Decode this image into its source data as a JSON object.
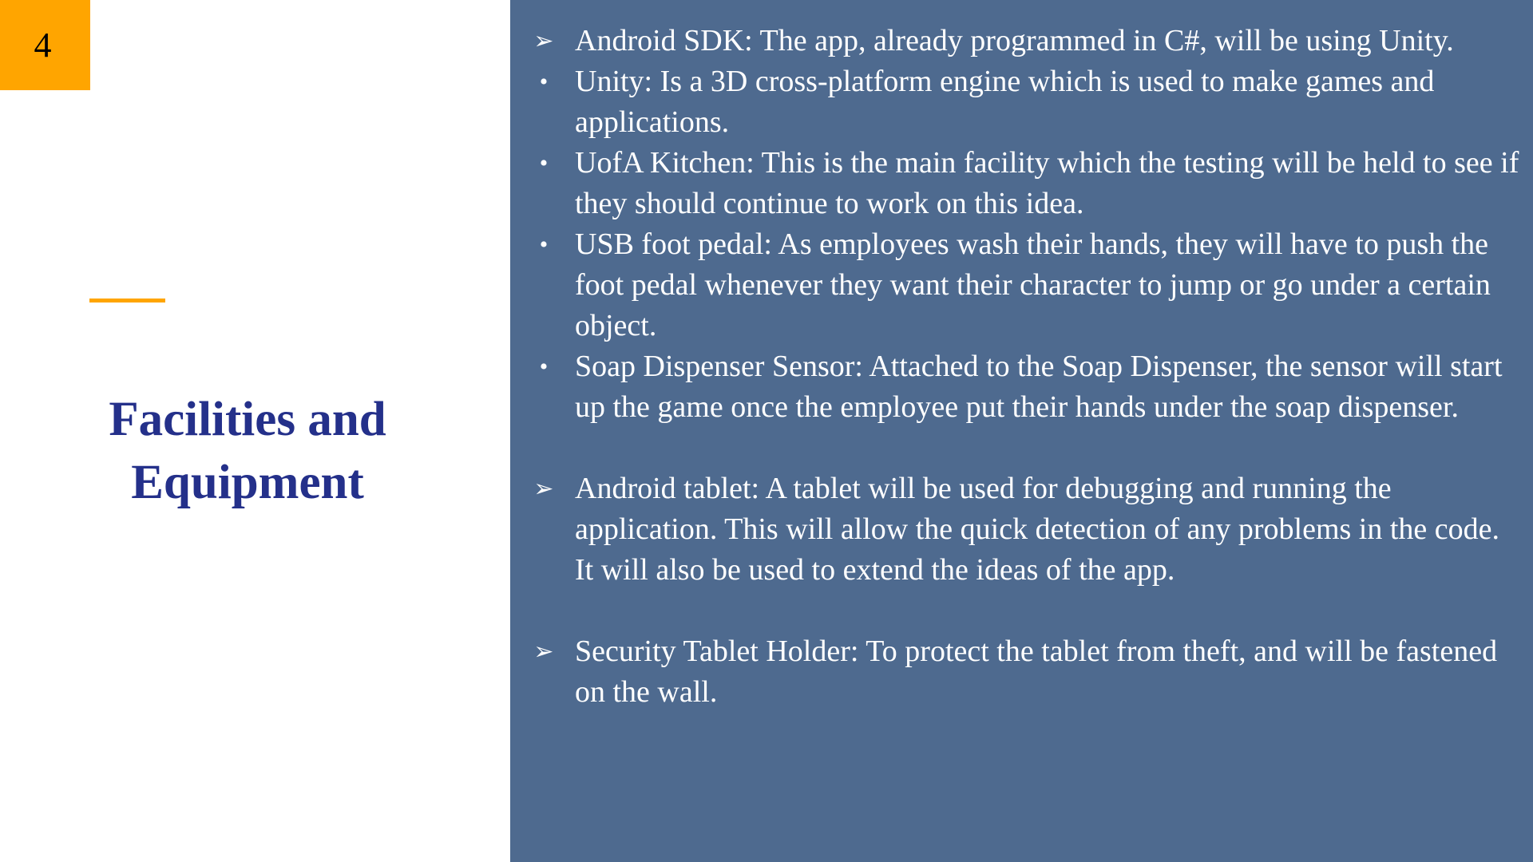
{
  "slide": {
    "number": "4",
    "title_line1": "Facilities and",
    "title_line2": "Equipment"
  },
  "colors": {
    "accent": "#FFA500",
    "title": "#24308A",
    "panel": "#4E6A8F",
    "body_text": "#FFFFFF"
  },
  "content": {
    "arrow_glyph": "➢",
    "bullet_glyph": "•",
    "items": [
      "Android SDK: The app, already programmed in C#, will be using Unity.",
      "Unity: Is a 3D cross-platform engine which is used to make games and applications.",
      "UofA Kitchen: This is the main facility which the testing will be held to see if they should continue to work on this idea.",
      "USB foot pedal: As employees wash their hands, they will have to push the foot pedal whenever they want their character to jump or go under a certain object.",
      "Soap Dispenser Sensor: Attached to the Soap Dispenser, the sensor will start up the game once the employee put their hands under the soap dispenser.",
      "Android tablet: A tablet will be used for debugging and running the application. This will allow the quick detection of any problems in the code. It will also be used to extend the ideas of the app.",
      "Security Tablet Holder: To protect the tablet from theft, and will be fastened on the wall."
    ]
  }
}
